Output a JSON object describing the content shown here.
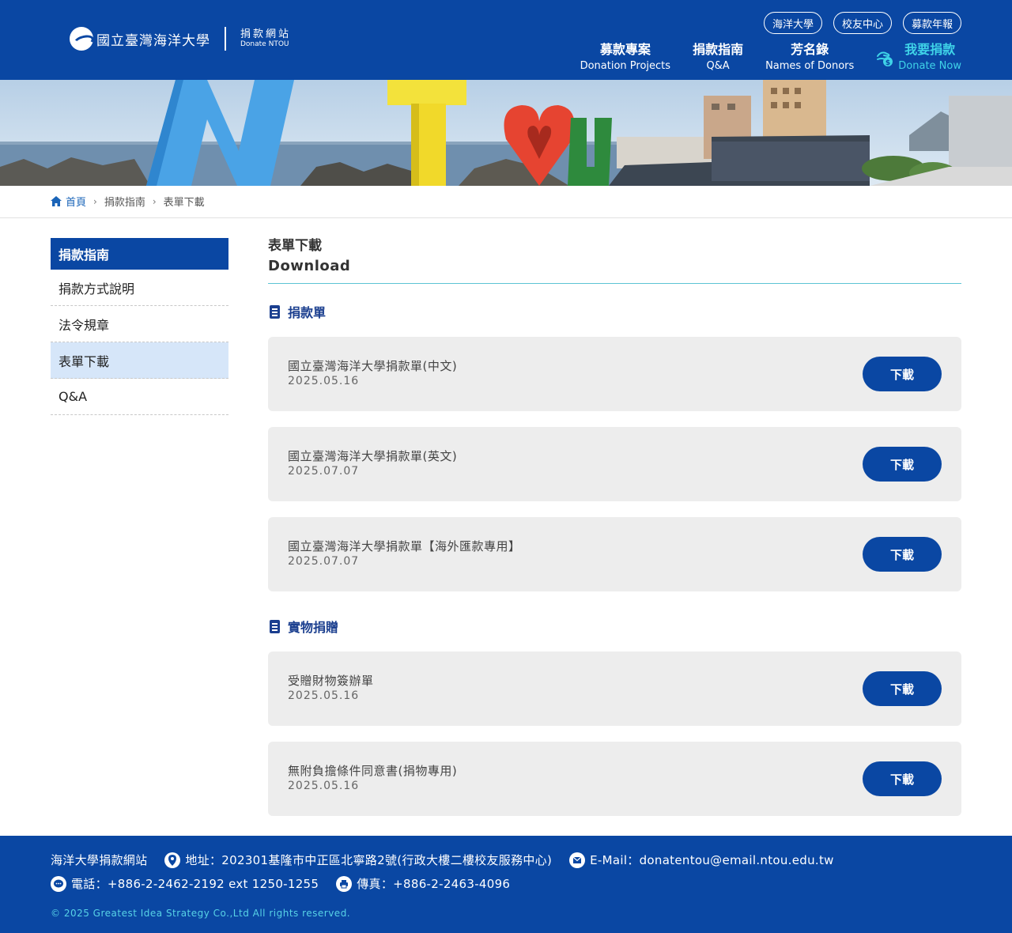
{
  "header": {
    "logo_name": "國立臺灣海洋大學",
    "site_zh": "捐款網站",
    "site_en": "Donate NTOU",
    "top_links": [
      "海洋大學",
      "校友中心",
      "募款年報"
    ],
    "nav": [
      {
        "zh": "募款專案",
        "en": "Donation Projects"
      },
      {
        "zh": "捐款指南",
        "en": "Q&A"
      },
      {
        "zh": "芳名錄",
        "en": "Names of Donors"
      }
    ],
    "donate": {
      "zh": "我要捐款",
      "en": "Donate Now"
    }
  },
  "banner": {
    "letters": [
      "N",
      "T",
      "U"
    ]
  },
  "breadcrumb": {
    "home": "首頁",
    "level1": "捐款指南",
    "level2": "表單下載"
  },
  "sidebar": {
    "title": "捐款指南",
    "items": [
      "捐款方式說明",
      "法令規章",
      "表單下載",
      "Q&A"
    ],
    "active_index": 2
  },
  "content": {
    "title_zh": "表單下載",
    "title_en": "Download",
    "sections": [
      {
        "title": "捐款單",
        "items": [
          {
            "name": "國立臺灣海洋大學捐款單(中文)",
            "date": "2025.05.16",
            "button": "下載"
          },
          {
            "name": "國立臺灣海洋大學捐款單(英文)",
            "date": "2025.07.07",
            "button": "下載"
          },
          {
            "name": "國立臺灣海洋大學捐款單【海外匯款專用】",
            "date": "2025.07.07",
            "button": "下載"
          }
        ]
      },
      {
        "title": "實物捐贈",
        "items": [
          {
            "name": "受贈財物簽辦單",
            "date": "2025.05.16",
            "button": "下載"
          },
          {
            "name": "無附負擔條件同意書(捐物專用)",
            "date": "2025.05.16",
            "button": "下載"
          }
        ]
      }
    ]
  },
  "footer": {
    "site_name": "海洋大學捐款網站",
    "address": "地址：202301基隆市中正區北寧路2號(行政大樓二樓校友服務中心)",
    "email": "E-Mail：donatentou@email.ntou.edu.tw",
    "phone": "電話：+886-2-2462-2192 ext 1250-1255",
    "fax": "傳真：+886-2-2463-4096",
    "copyright": "© 2025 Greatest Idea Strategy Co.,Ltd All rights reserved."
  },
  "colors": {
    "brand": "#0a47a3",
    "accent": "#3fd3e8",
    "active_bg": "#d6e6f9",
    "card_bg": "#ededed"
  }
}
